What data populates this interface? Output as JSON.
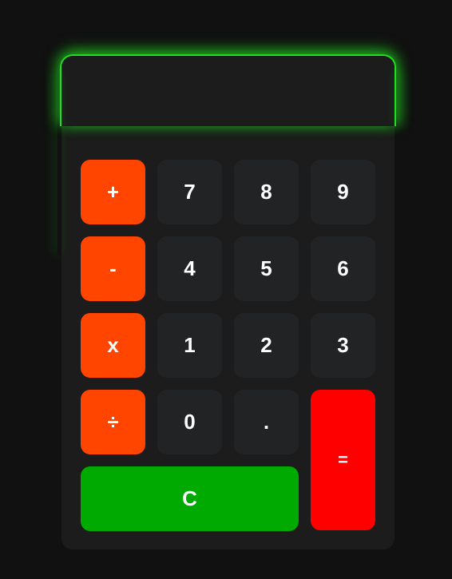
{
  "display": {
    "value": ""
  },
  "keys": {
    "plus": "+",
    "minus": "-",
    "multiply": "x",
    "divide": "÷",
    "seven": "7",
    "eight": "8",
    "nine": "9",
    "four": "4",
    "five": "5",
    "six": "6",
    "one": "1",
    "two": "2",
    "three": "3",
    "zero": "0",
    "decimal": ".",
    "equals": "=",
    "clear": "C"
  },
  "colors": {
    "background": "#111111",
    "body": "#1c1c1c",
    "number_key": "#222324",
    "operator_key": "#ff4500",
    "equals_key": "#ff0000",
    "clear_key": "#00aa00",
    "glow": "#22dd22"
  }
}
